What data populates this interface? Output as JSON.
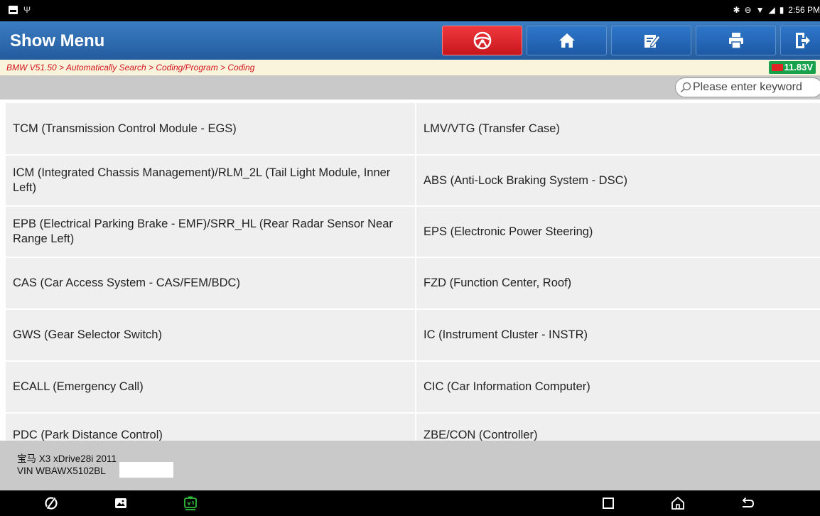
{
  "status_bar": {
    "time": "2:56 PM",
    "icons": [
      "notification-square-icon",
      "usb-icon",
      "bluetooth-icon",
      "do-not-disturb-icon",
      "wifi-icon",
      "signal-icon",
      "battery-icon"
    ]
  },
  "header": {
    "title": "Show Menu",
    "buttons": [
      {
        "name": "steering-wheel-button",
        "icon": "steering-wheel-icon",
        "color": "#d8161d"
      },
      {
        "name": "home-button",
        "icon": "home-icon"
      },
      {
        "name": "edit-report-button",
        "icon": "edit-icon"
      },
      {
        "name": "print-button",
        "icon": "printer-icon"
      },
      {
        "name": "exit-button",
        "icon": "exit-icon"
      }
    ]
  },
  "breadcrumb": {
    "path": "BMW V51.50 > Automatically Search > Coding/Program > Coding",
    "voltage": "11.83V",
    "path_color": "#d2121a",
    "voltage_color": "#18a24b"
  },
  "search": {
    "placeholder": "Please enter keyword"
  },
  "modules": [
    {
      "left": "TCM (Transmission Control Module - EGS)",
      "right": "LMV/VTG (Transfer Case)"
    },
    {
      "left": "ICM (Integrated Chassis Management)/RLM_2L (Tail Light Module, Inner Left)",
      "right": "ABS (Anti-Lock Braking System - DSC)"
    },
    {
      "left": "EPB (Electrical Parking Brake - EMF)/SRR_HL (Rear Radar Sensor Near Range Left)",
      "right": "EPS (Electronic Power Steering)"
    },
    {
      "left": "CAS (Car Access System - CAS/FEM/BDC)",
      "right": "FZD (Function Center, Roof)"
    },
    {
      "left": "GWS (Gear Selector Switch)",
      "right": "IC (Instrument Cluster - INSTR)"
    },
    {
      "left": "ECALL (Emergency Call)",
      "right": "CIC (Car Information Computer)"
    },
    {
      "left": "PDC (Park Distance Control)",
      "right": "ZBE/CON (Controller)"
    }
  ],
  "vehicle": {
    "model": "宝马 X3 xDrive28i 2011",
    "vin": "VIN WBAWX5102BL"
  },
  "nav_bar": {
    "icons": [
      "browser-icon",
      "gallery-icon",
      "vci-icon",
      "recents-icon",
      "home-icon",
      "back-icon"
    ],
    "vci_color": "#2fbf3a"
  }
}
